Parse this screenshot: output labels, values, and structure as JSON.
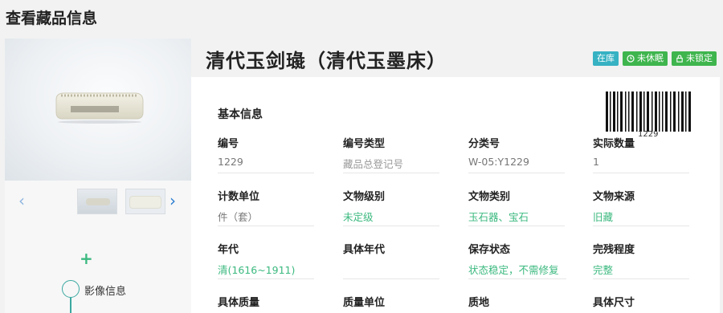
{
  "page": {
    "title": "查看藏品信息"
  },
  "item": {
    "title": "清代玉剑璏（清代玉墨床）",
    "badges": {
      "in_stock": "在库",
      "not_dormant": "未休眠",
      "not_locked": "未锁定"
    },
    "barcode_number": "1229"
  },
  "gallery": {
    "prev_icon": "‹",
    "next_icon": "›",
    "add_icon": "+"
  },
  "timeline": {
    "image_info_label": "影像信息"
  },
  "section": {
    "basic_info": "基本信息"
  },
  "fields": [
    {
      "label": "编号",
      "value": "1229"
    },
    {
      "label": "编号类型",
      "value": "藏品总登记号"
    },
    {
      "label": "分类号",
      "value": "W-05:Y1229"
    },
    {
      "label": "实际数量",
      "value": "1"
    },
    {
      "label": "计数单位",
      "value": "件（套）"
    },
    {
      "label": "文物级别",
      "value": "未定级"
    },
    {
      "label": "文物类别",
      "value": "玉石器、宝石"
    },
    {
      "label": "文物来源",
      "value": "旧藏"
    },
    {
      "label": "年代",
      "value": "清(1616~1911)"
    },
    {
      "label": "具体年代",
      "value": ""
    },
    {
      "label": "保存状态",
      "value": "状态稳定，不需修复"
    },
    {
      "label": "完残程度",
      "value": "完整"
    },
    {
      "label": "具体质量",
      "value": ""
    },
    {
      "label": "质量单位",
      "value": ""
    },
    {
      "label": "质地",
      "value": ""
    },
    {
      "label": "具体尺寸",
      "value": ""
    }
  ],
  "colors": {
    "accent_green": "#3bb97f",
    "badge_teal": "#36b2c3",
    "badge_green": "#3fb54e"
  }
}
